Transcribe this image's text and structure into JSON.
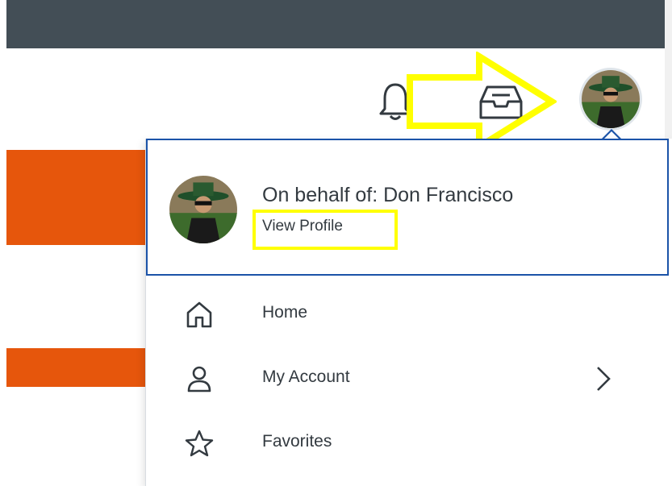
{
  "header": {
    "notifications_icon": "bell-icon",
    "inbox_icon": "inbox-icon",
    "profile_icon": "avatar"
  },
  "profile_menu": {
    "behalf_text": "On behalf of: Don Francisco",
    "view_profile_label": "View Profile",
    "items": [
      {
        "label": "Home",
        "icon": "home-icon"
      },
      {
        "label": "My Account",
        "icon": "person-icon",
        "has_submenu": true
      },
      {
        "label": "Favorites",
        "icon": "star-icon"
      }
    ]
  },
  "colors": {
    "topbar": "#434e56",
    "accent_orange": "#e6560c",
    "menu_border": "#1b53a8",
    "annotation": "#ffff00"
  }
}
